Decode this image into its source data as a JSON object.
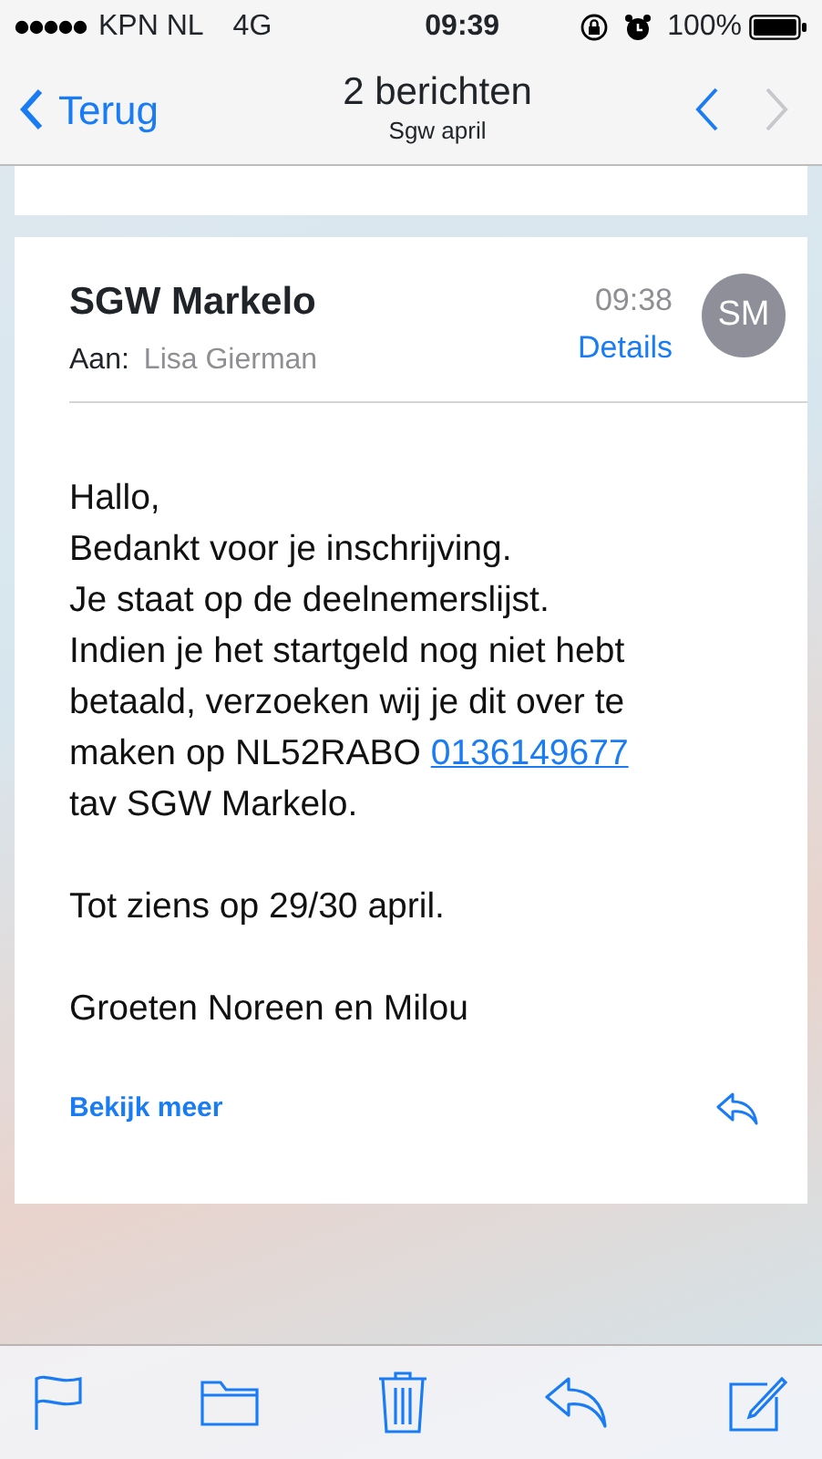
{
  "status_bar": {
    "carrier": "KPN NL",
    "network": "4G",
    "time": "09:39",
    "battery": "100%"
  },
  "nav_bar": {
    "back": "Terug",
    "title": "2 berichten",
    "subtitle": "Sgw april",
    "previous_disabled": false,
    "next_disabled": true
  },
  "message": {
    "sender": "SGW Markelo",
    "to_label": "Aan:",
    "to": "Lisa Gierman",
    "time": "09:38",
    "details": "Details",
    "avatar": "SM",
    "paragraphs": [
      {
        "lines": [
          {
            "text": "Hallo,"
          },
          {
            "text": "Bedankt voor je inschrijving."
          },
          {
            "text": "Je staat op de deelnemerslijst."
          },
          {
            "text": "Indien je het startgeld nog niet hebt"
          },
          {
            "text": "betaald, verzoeken wij je dit over te"
          },
          {
            "text": "maken op NL52RABO ",
            "link": "0136149677"
          },
          {
            "text": "tav SGW Markelo."
          }
        ]
      },
      {
        "lines": [
          {
            "text": "Tot ziens op 29/30 april."
          }
        ]
      },
      {
        "lines": [
          {
            "text": "Groeten Noreen en Milou"
          }
        ]
      }
    ],
    "more": "Bekijk meer"
  },
  "toolbar": [
    {
      "kind": "flag"
    },
    {
      "kind": "folder"
    },
    {
      "kind": "trash"
    },
    {
      "kind": "reply"
    },
    {
      "kind": "compose"
    }
  ]
}
